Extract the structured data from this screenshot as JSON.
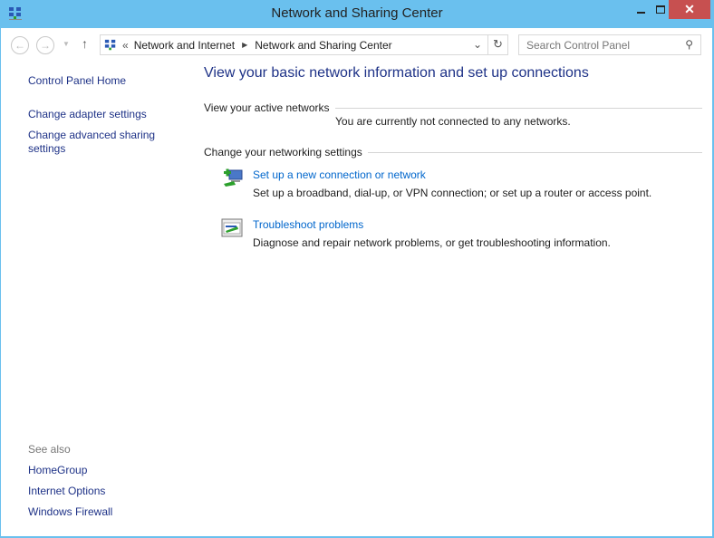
{
  "window": {
    "title": "Network and Sharing Center"
  },
  "nav": {
    "breadcrumb": [
      "Network and Internet",
      "Network and Sharing Center"
    ],
    "overflow": "«",
    "search_placeholder": "Search Control Panel"
  },
  "sidebar": {
    "home": "Control Panel Home",
    "links": [
      "Change adapter settings",
      "Change advanced sharing",
      "settings"
    ],
    "see_also_label": "See also",
    "see_also": [
      "HomeGroup",
      "Internet Options",
      "Windows Firewall"
    ]
  },
  "main": {
    "heading": "View your basic network information and set up connections",
    "active_networks": {
      "label": "View your active networks",
      "status": "You are currently not connected to any networks."
    },
    "settings": {
      "label": "Change your networking settings",
      "items": [
        {
          "title": "Set up a new connection or network",
          "desc": "Set up a broadband, dial-up, or VPN connection; or set up a router or access point.",
          "icon": "new-connection-icon"
        },
        {
          "title": "Troubleshoot problems",
          "desc": "Diagnose and repair network problems, or get troubleshooting information.",
          "icon": "troubleshoot-icon"
        }
      ]
    }
  },
  "colors": {
    "titlebar": "#6ac0ee",
    "close": "#c75050",
    "link": "#1e3287"
  }
}
